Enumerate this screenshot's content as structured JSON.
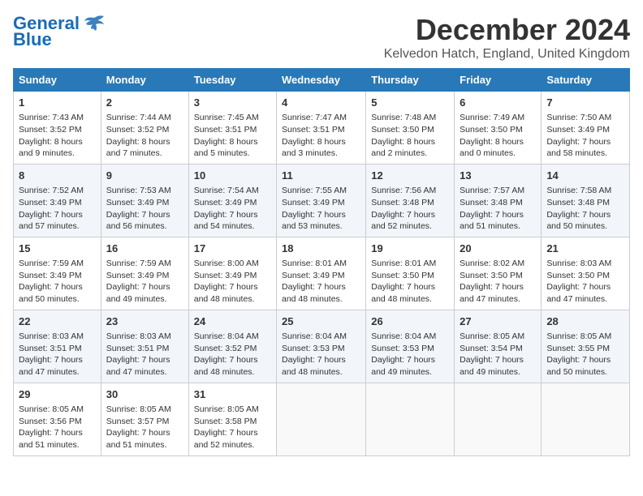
{
  "logo": {
    "line1": "General",
    "line2": "Blue"
  },
  "title": "December 2024",
  "location": "Kelvedon Hatch, England, United Kingdom",
  "days_of_week": [
    "Sunday",
    "Monday",
    "Tuesday",
    "Wednesday",
    "Thursday",
    "Friday",
    "Saturday"
  ],
  "weeks": [
    [
      {
        "day": 1,
        "sunrise": "7:43 AM",
        "sunset": "3:52 PM",
        "daylight": "8 hours and 9 minutes."
      },
      {
        "day": 2,
        "sunrise": "7:44 AM",
        "sunset": "3:52 PM",
        "daylight": "8 hours and 7 minutes."
      },
      {
        "day": 3,
        "sunrise": "7:45 AM",
        "sunset": "3:51 PM",
        "daylight": "8 hours and 5 minutes."
      },
      {
        "day": 4,
        "sunrise": "7:47 AM",
        "sunset": "3:51 PM",
        "daylight": "8 hours and 3 minutes."
      },
      {
        "day": 5,
        "sunrise": "7:48 AM",
        "sunset": "3:50 PM",
        "daylight": "8 hours and 2 minutes."
      },
      {
        "day": 6,
        "sunrise": "7:49 AM",
        "sunset": "3:50 PM",
        "daylight": "8 hours and 0 minutes."
      },
      {
        "day": 7,
        "sunrise": "7:50 AM",
        "sunset": "3:49 PM",
        "daylight": "7 hours and 58 minutes."
      }
    ],
    [
      {
        "day": 8,
        "sunrise": "7:52 AM",
        "sunset": "3:49 PM",
        "daylight": "7 hours and 57 minutes."
      },
      {
        "day": 9,
        "sunrise": "7:53 AM",
        "sunset": "3:49 PM",
        "daylight": "7 hours and 56 minutes."
      },
      {
        "day": 10,
        "sunrise": "7:54 AM",
        "sunset": "3:49 PM",
        "daylight": "7 hours and 54 minutes."
      },
      {
        "day": 11,
        "sunrise": "7:55 AM",
        "sunset": "3:49 PM",
        "daylight": "7 hours and 53 minutes."
      },
      {
        "day": 12,
        "sunrise": "7:56 AM",
        "sunset": "3:48 PM",
        "daylight": "7 hours and 52 minutes."
      },
      {
        "day": 13,
        "sunrise": "7:57 AM",
        "sunset": "3:48 PM",
        "daylight": "7 hours and 51 minutes."
      },
      {
        "day": 14,
        "sunrise": "7:58 AM",
        "sunset": "3:48 PM",
        "daylight": "7 hours and 50 minutes."
      }
    ],
    [
      {
        "day": 15,
        "sunrise": "7:59 AM",
        "sunset": "3:49 PM",
        "daylight": "7 hours and 50 minutes."
      },
      {
        "day": 16,
        "sunrise": "7:59 AM",
        "sunset": "3:49 PM",
        "daylight": "7 hours and 49 minutes."
      },
      {
        "day": 17,
        "sunrise": "8:00 AM",
        "sunset": "3:49 PM",
        "daylight": "7 hours and 48 minutes."
      },
      {
        "day": 18,
        "sunrise": "8:01 AM",
        "sunset": "3:49 PM",
        "daylight": "7 hours and 48 minutes."
      },
      {
        "day": 19,
        "sunrise": "8:01 AM",
        "sunset": "3:50 PM",
        "daylight": "7 hours and 48 minutes."
      },
      {
        "day": 20,
        "sunrise": "8:02 AM",
        "sunset": "3:50 PM",
        "daylight": "7 hours and 47 minutes."
      },
      {
        "day": 21,
        "sunrise": "8:03 AM",
        "sunset": "3:50 PM",
        "daylight": "7 hours and 47 minutes."
      }
    ],
    [
      {
        "day": 22,
        "sunrise": "8:03 AM",
        "sunset": "3:51 PM",
        "daylight": "7 hours and 47 minutes."
      },
      {
        "day": 23,
        "sunrise": "8:03 AM",
        "sunset": "3:51 PM",
        "daylight": "7 hours and 47 minutes."
      },
      {
        "day": 24,
        "sunrise": "8:04 AM",
        "sunset": "3:52 PM",
        "daylight": "7 hours and 48 minutes."
      },
      {
        "day": 25,
        "sunrise": "8:04 AM",
        "sunset": "3:53 PM",
        "daylight": "7 hours and 48 minutes."
      },
      {
        "day": 26,
        "sunrise": "8:04 AM",
        "sunset": "3:53 PM",
        "daylight": "7 hours and 49 minutes."
      },
      {
        "day": 27,
        "sunrise": "8:05 AM",
        "sunset": "3:54 PM",
        "daylight": "7 hours and 49 minutes."
      },
      {
        "day": 28,
        "sunrise": "8:05 AM",
        "sunset": "3:55 PM",
        "daylight": "7 hours and 50 minutes."
      }
    ],
    [
      {
        "day": 29,
        "sunrise": "8:05 AM",
        "sunset": "3:56 PM",
        "daylight": "7 hours and 51 minutes."
      },
      {
        "day": 30,
        "sunrise": "8:05 AM",
        "sunset": "3:57 PM",
        "daylight": "7 hours and 51 minutes."
      },
      {
        "day": 31,
        "sunrise": "8:05 AM",
        "sunset": "3:58 PM",
        "daylight": "7 hours and 52 minutes."
      },
      null,
      null,
      null,
      null
    ]
  ]
}
